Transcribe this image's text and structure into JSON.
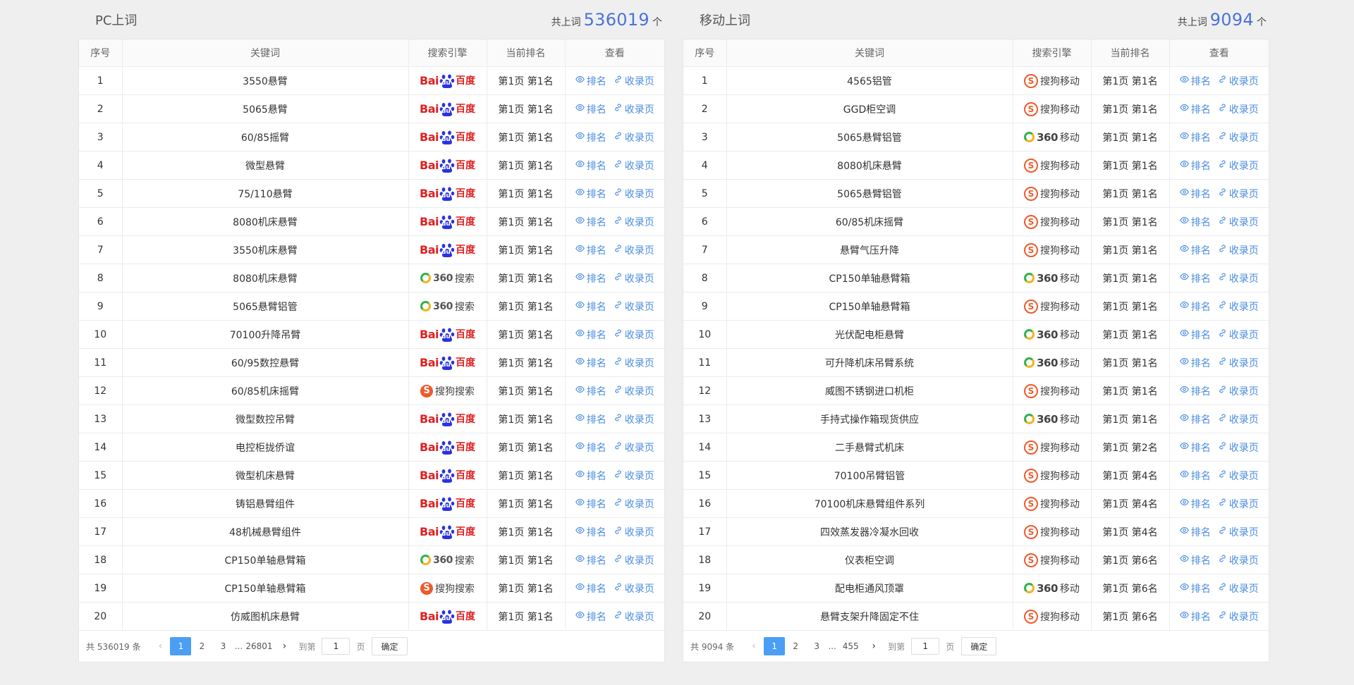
{
  "pc": {
    "title": "PC上词",
    "total_prefix": "共上词",
    "total_value": "536019",
    "total_suffix": "个",
    "columns": [
      "序号",
      "关键词",
      "搜索引擎",
      "当前排名",
      "查看"
    ],
    "rows": [
      {
        "index": "1",
        "keyword": "3550悬臂",
        "engine": "baidu",
        "rank": "第1页 第1名"
      },
      {
        "index": "2",
        "keyword": "5065悬臂",
        "engine": "baidu",
        "rank": "第1页 第1名"
      },
      {
        "index": "3",
        "keyword": "60/85摇臂",
        "engine": "baidu",
        "rank": "第1页 第1名"
      },
      {
        "index": "4",
        "keyword": "微型悬臂",
        "engine": "baidu",
        "rank": "第1页 第1名"
      },
      {
        "index": "5",
        "keyword": "75/110悬臂",
        "engine": "baidu",
        "rank": "第1页 第1名"
      },
      {
        "index": "6",
        "keyword": "8080机床悬臂",
        "engine": "baidu",
        "rank": "第1页 第1名"
      },
      {
        "index": "7",
        "keyword": "3550机床悬臂",
        "engine": "baidu",
        "rank": "第1页 第1名"
      },
      {
        "index": "8",
        "keyword": "8080机床悬臂",
        "engine": "360",
        "rank": "第1页 第1名"
      },
      {
        "index": "9",
        "keyword": "5065悬臂铝管",
        "engine": "360",
        "rank": "第1页 第1名"
      },
      {
        "index": "10",
        "keyword": "70100升降吊臂",
        "engine": "baidu",
        "rank": "第1页 第1名"
      },
      {
        "index": "11",
        "keyword": "60/95数控悬臂",
        "engine": "baidu",
        "rank": "第1页 第1名"
      },
      {
        "index": "12",
        "keyword": "60/85机床摇臂",
        "engine": "sogou",
        "rank": "第1页 第1名"
      },
      {
        "index": "13",
        "keyword": "微型数控吊臂",
        "engine": "baidu",
        "rank": "第1页 第1名"
      },
      {
        "index": "14",
        "keyword": "电控柜拢侨谊",
        "engine": "baidu",
        "rank": "第1页 第1名"
      },
      {
        "index": "15",
        "keyword": "微型机床悬臂",
        "engine": "baidu",
        "rank": "第1页 第1名"
      },
      {
        "index": "16",
        "keyword": "铸铝悬臂组件",
        "engine": "baidu",
        "rank": "第1页 第1名"
      },
      {
        "index": "17",
        "keyword": "48机械悬臂组件",
        "engine": "baidu",
        "rank": "第1页 第1名"
      },
      {
        "index": "18",
        "keyword": "CP150单轴悬臂箱",
        "engine": "360",
        "rank": "第1页 第1名"
      },
      {
        "index": "19",
        "keyword": "CP150单轴悬臂箱",
        "engine": "sogou",
        "rank": "第1页 第1名"
      },
      {
        "index": "20",
        "keyword": "仿威图机床悬臂",
        "engine": "baidu",
        "rank": "第1页 第1名"
      }
    ],
    "pager": {
      "total_text": "共 536019 条",
      "pages": [
        "1",
        "2",
        "3"
      ],
      "ellipsis": "...",
      "last_page": "26801",
      "goto_label": "到第",
      "goto_value": "1",
      "page_unit": "页",
      "confirm": "确定"
    }
  },
  "mobile": {
    "title": "移动上词",
    "total_prefix": "共上词",
    "total_value": "9094",
    "total_suffix": "个",
    "columns": [
      "序号",
      "关键词",
      "搜索引擎",
      "当前排名",
      "查看"
    ],
    "rows": [
      {
        "index": "1",
        "keyword": "4565铝管",
        "engine": "sogou-m",
        "rank": "第1页 第1名"
      },
      {
        "index": "2",
        "keyword": "GGD柜空调",
        "engine": "sogou-m",
        "rank": "第1页 第1名"
      },
      {
        "index": "3",
        "keyword": "5065悬臂铝管",
        "engine": "360-m",
        "rank": "第1页 第1名"
      },
      {
        "index": "4",
        "keyword": "8080机床悬臂",
        "engine": "sogou-m",
        "rank": "第1页 第1名"
      },
      {
        "index": "5",
        "keyword": "5065悬臂铝管",
        "engine": "sogou-m",
        "rank": "第1页 第1名"
      },
      {
        "index": "6",
        "keyword": "60/85机床摇臂",
        "engine": "sogou-m",
        "rank": "第1页 第1名"
      },
      {
        "index": "7",
        "keyword": "悬臂气压升降",
        "engine": "sogou-m",
        "rank": "第1页 第1名"
      },
      {
        "index": "8",
        "keyword": "CP150单轴悬臂箱",
        "engine": "360-m",
        "rank": "第1页 第1名"
      },
      {
        "index": "9",
        "keyword": "CP150单轴悬臂箱",
        "engine": "sogou-m",
        "rank": "第1页 第1名"
      },
      {
        "index": "10",
        "keyword": "光伏配电柜悬臂",
        "engine": "360-m",
        "rank": "第1页 第1名"
      },
      {
        "index": "11",
        "keyword": "可升降机床吊臂系统",
        "engine": "360-m",
        "rank": "第1页 第1名"
      },
      {
        "index": "12",
        "keyword": "威图不锈钢进口机柜",
        "engine": "sogou-m",
        "rank": "第1页 第1名"
      },
      {
        "index": "13",
        "keyword": "手持式操作箱现货供应",
        "engine": "360-m",
        "rank": "第1页 第1名"
      },
      {
        "index": "14",
        "keyword": "二手悬臂式机床",
        "engine": "sogou-m",
        "rank": "第1页 第2名"
      },
      {
        "index": "15",
        "keyword": "70100吊臂铝管",
        "engine": "sogou-m",
        "rank": "第1页 第4名"
      },
      {
        "index": "16",
        "keyword": "70100机床悬臂组件系列",
        "engine": "sogou-m",
        "rank": "第1页 第4名"
      },
      {
        "index": "17",
        "keyword": "四效蒸发器冷凝水回收",
        "engine": "sogou-m",
        "rank": "第1页 第4名"
      },
      {
        "index": "18",
        "keyword": "仪表柜空调",
        "engine": "sogou-m",
        "rank": "第1页 第6名"
      },
      {
        "index": "19",
        "keyword": "配电柜通风顶罩",
        "engine": "360-m",
        "rank": "第1页 第6名"
      },
      {
        "index": "20",
        "keyword": "悬臂支架升降固定不住",
        "engine": "sogou-m",
        "rank": "第1页 第6名"
      }
    ],
    "pager": {
      "total_text": "共 9094 条",
      "pages": [
        "1",
        "2",
        "3"
      ],
      "ellipsis": "...",
      "last_page": "455",
      "goto_label": "到第",
      "goto_value": "1",
      "page_unit": "页",
      "confirm": "确定"
    }
  },
  "engines": {
    "baidu": {
      "icon": "baidu-logo-icon",
      "text_a": "Bai",
      "text_b": "du",
      "text_c": "百度"
    },
    "360": {
      "icon": "360-search-logo-icon",
      "text_a": "360",
      "text_b": "搜索"
    },
    "360-m": {
      "icon": "360-mobile-logo-icon",
      "text_a": "360",
      "text_b": "移动"
    },
    "sogou": {
      "icon": "sogou-search-logo-icon",
      "text_a": "S",
      "text_b": "搜狗搜索"
    },
    "sogou-m": {
      "icon": "sogou-mobile-logo-icon",
      "text_a": "S",
      "text_b": "搜狗移动"
    }
  },
  "actions": {
    "rank_label": "排名",
    "index_label": "收录页"
  },
  "colors": {
    "accent": "#4b73d8",
    "link": "#4a8ce0",
    "pager_active": "#4a9ff5",
    "baidu_red": "#e02020",
    "baidu_blue": "#2932e1",
    "green_360": "#32b24a",
    "sogou_orange": "#ee5a2b"
  }
}
